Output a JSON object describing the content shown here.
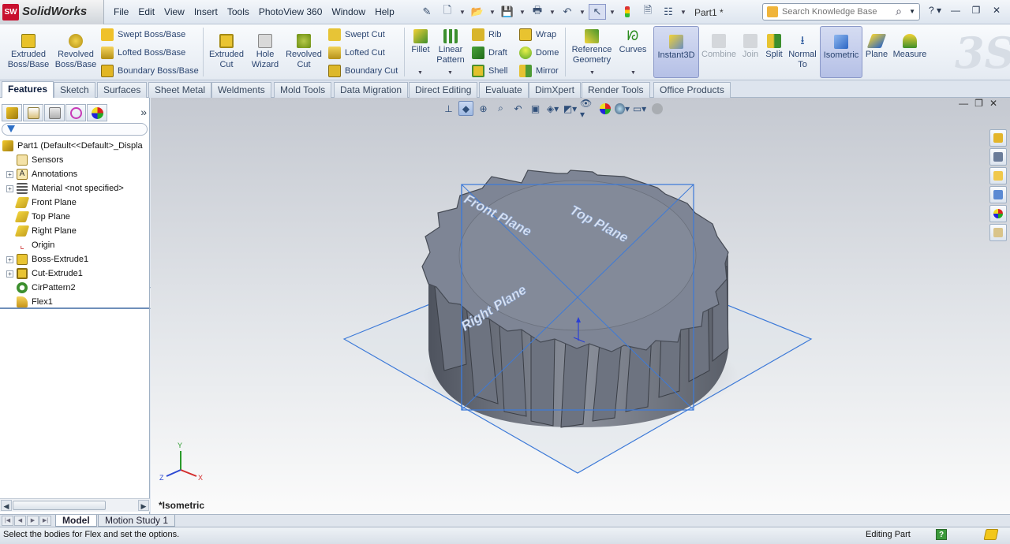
{
  "app": {
    "logo_text": "SolidWorks",
    "logo_badge": "SW",
    "doc_title": "Part1 *",
    "search_placeholder": "Search Knowledge Base",
    "menus": [
      "File",
      "Edit",
      "View",
      "Insert",
      "Tools",
      "PhotoView 360",
      "Window",
      "Help"
    ]
  },
  "command_manager": {
    "extruded_boss": "Extruded Boss/Base",
    "revolved_boss": "Revolved Boss/Base",
    "swept_boss": "Swept Boss/Base",
    "lofted_boss": "Lofted Boss/Base",
    "boundary_boss": "Boundary Boss/Base",
    "extruded_cut": "Extruded Cut",
    "hole_wizard": "Hole Wizard",
    "revolved_cut": "Revolved Cut",
    "swept_cut": "Swept Cut",
    "lofted_cut": "Lofted Cut",
    "boundary_cut": "Boundary Cut",
    "fillet": "Fillet",
    "linear_pattern": "Linear Pattern",
    "rib": "Rib",
    "draft": "Draft",
    "shell": "Shell",
    "wrap": "Wrap",
    "dome": "Dome",
    "mirror": "Mirror",
    "reference_geometry": "Reference Geometry",
    "curves": "Curves",
    "instant3d": "Instant3D",
    "combine": "Combine",
    "join": "Join",
    "split": "Split",
    "normal_to": "Normal To",
    "isometric": "Isometric",
    "plane": "Plane",
    "measure": "Measure"
  },
  "tabs": [
    "Features",
    "Sketch",
    "Surfaces",
    "Sheet Metal",
    "Weldments",
    "Mold Tools",
    "Data Migration",
    "Direct Editing",
    "Evaluate",
    "DimXpert",
    "Render Tools",
    "Office Products"
  ],
  "feature_tree": {
    "root": "Part1  (Default<<Default>_Displa",
    "items": [
      {
        "label": "Sensors",
        "expandable": false
      },
      {
        "label": "Annotations",
        "expandable": true
      },
      {
        "label": "Material <not specified>",
        "expandable": true
      },
      {
        "label": "Front Plane",
        "expandable": false
      },
      {
        "label": "Top Plane",
        "expandable": false
      },
      {
        "label": "Right Plane",
        "expandable": false
      },
      {
        "label": "Origin",
        "expandable": false
      },
      {
        "label": "Boss-Extrude1",
        "expandable": true
      },
      {
        "label": "Cut-Extrude1",
        "expandable": true
      },
      {
        "label": "CirPattern2",
        "expandable": false
      },
      {
        "label": "Flex1",
        "expandable": false
      }
    ]
  },
  "viewport": {
    "view_name": "*Isometric",
    "plane_labels": {
      "front": "Front Plane",
      "top": "Top Plane",
      "right": "Right Plane"
    },
    "triad": {
      "x": "X",
      "y": "Y",
      "z": "Z"
    },
    "colors": {
      "plane_edge": "#3d7ad8",
      "gear_face": "#7e8595",
      "gear_side": "#5f6573"
    }
  },
  "bottom_tabs": [
    "Model",
    "Motion Study 1"
  ],
  "status": {
    "message": "Select the bodies for Flex and set the options.",
    "mode": "Editing Part",
    "help_icon": "?"
  },
  "accent_colors": {
    "pressed": "#b5c0e6",
    "link": "#2a4470"
  }
}
